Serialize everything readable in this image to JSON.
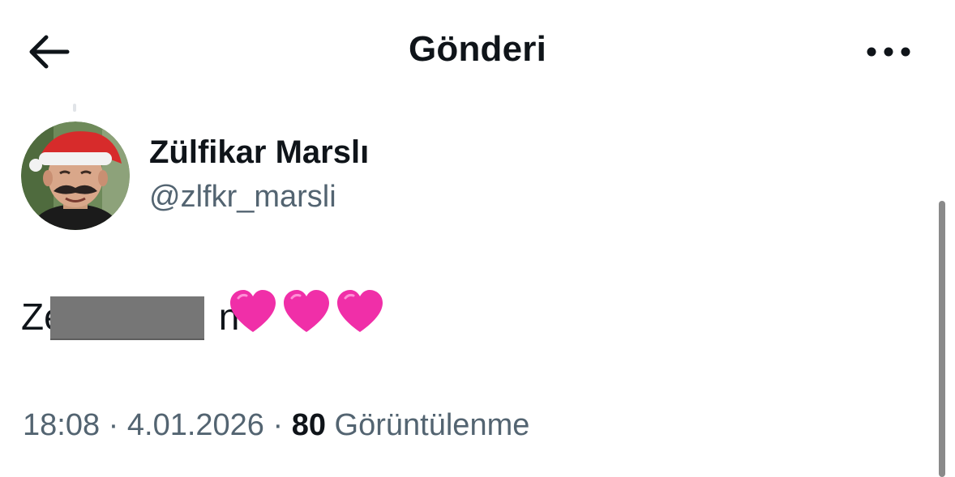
{
  "header": {
    "back_icon": "arrow-left-icon",
    "title": "Gönderi",
    "more_icon": "ellipsis-horizontal-icon"
  },
  "author": {
    "name": "Zülfikar Marslı",
    "handle": "@zlfkr_marsli",
    "avatar_icon": "user-avatar-photo"
  },
  "tweet": {
    "text_visible_start": "Ze",
    "text_visible_end": "n",
    "emoji": [
      "💗",
      "💗",
      "💗"
    ],
    "emoji_color": "#f02fa8"
  },
  "meta": {
    "time": "18:08",
    "separator": " · ",
    "date": "4.01.2026",
    "views_count": "80",
    "views_label": " Görüntülenme"
  },
  "colors": {
    "text_primary": "#0f1419",
    "text_secondary": "#536471",
    "background": "#ffffff",
    "redaction": "#767676"
  }
}
